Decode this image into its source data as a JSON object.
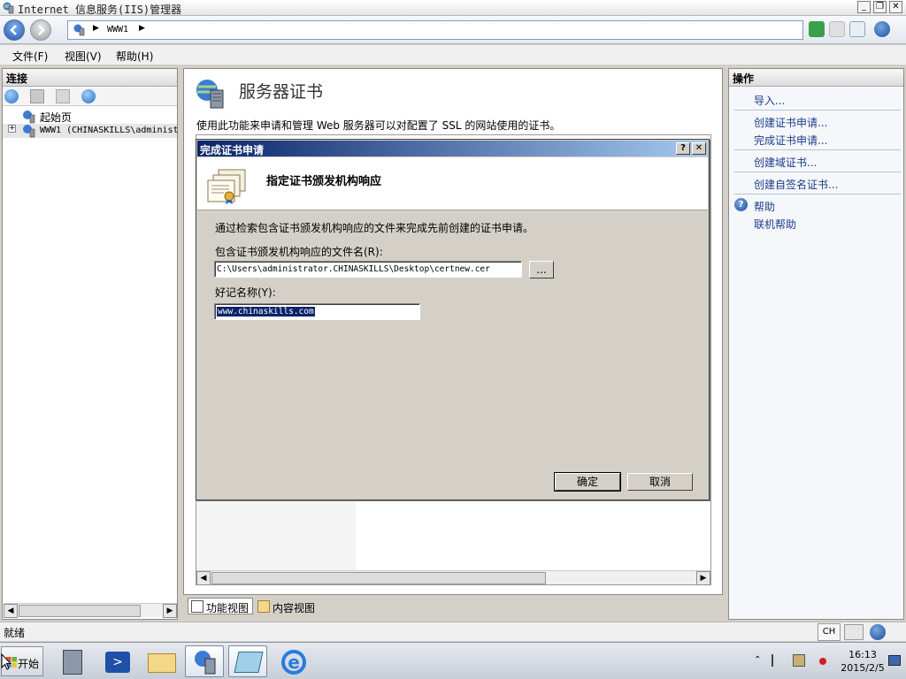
{
  "window": {
    "title": "Internet 信息服务(IIS)管理器",
    "min_label": "_",
    "max_label": "❐",
    "close_label": "✕"
  },
  "address": {
    "crumb": "WWW1",
    "arrow": "▶"
  },
  "menu": {
    "file": "文件(F)",
    "view": "视图(V)",
    "help": "帮助(H)"
  },
  "connections": {
    "header": "连接",
    "tree": [
      {
        "label": "起始页"
      },
      {
        "label": "WWW1 (CHINASKILLS\\administ"
      }
    ],
    "expander": "+"
  },
  "main": {
    "title": "服务器证书",
    "description": "使用此功能来申请和管理 Web 服务器可以对配置了 SSL 的网站使用的证书。"
  },
  "view_tabs": {
    "features": "功能视图",
    "content": "内容视图"
  },
  "actions": {
    "header": "操作",
    "import": "导入...",
    "create_request": "创建证书申请...",
    "complete_request": "完成证书申请...",
    "create_domain": "创建域证书...",
    "create_selfsigned": "创建自签名证书...",
    "help": "帮助",
    "online_help": "联机帮助"
  },
  "status": {
    "text": "就绪",
    "lang": "CH"
  },
  "taskbar": {
    "start": "开始",
    "time": "16:13",
    "date": "2015/2/5"
  },
  "dialog": {
    "title": "完成证书申请",
    "help_btn": "?",
    "close_btn": "✕",
    "heading": "指定证书颁发机构响应",
    "instruction": "通过检索包含证书颁发机构响应的文件来完成先前创建的证书申请。",
    "file_label": "包含证书颁发机构响应的文件名(R):",
    "file_value": "C:\\Users\\administrator.CHINASKILLS\\Desktop\\certnew.cer",
    "browse_label": "...",
    "friendly_label": "好记名称(Y):",
    "friendly_value": "www.chinaskills.com",
    "ok_label": "确定",
    "cancel_label": "取消"
  },
  "scroll": {
    "left": "◀",
    "right": "▶"
  }
}
